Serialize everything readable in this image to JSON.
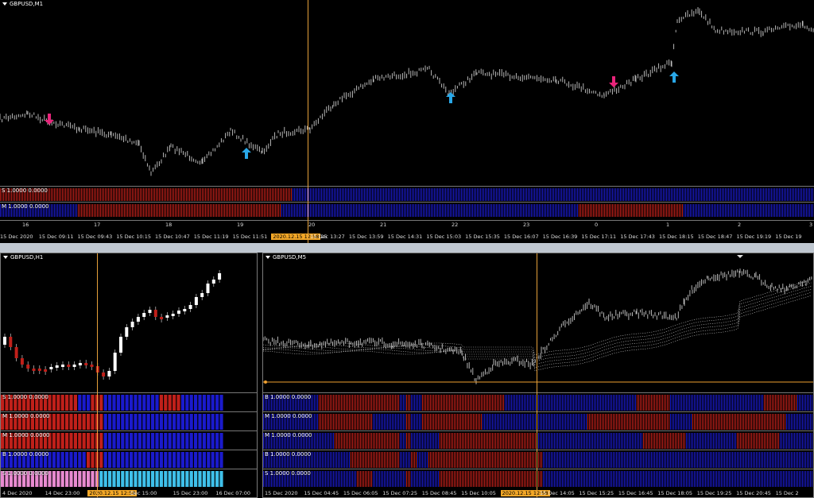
{
  "colors": {
    "bull": "#1a1acc",
    "bear": "#c0201a",
    "cursor": "#f0a030",
    "up_arrow": "#29a8e8",
    "down_arrow": "#e8247a",
    "price": "#c8c8c8"
  },
  "top": {
    "title": "GBPUSD,M1",
    "bands": [
      {
        "label": "S 1.0000 0.0000",
        "segments": [
          [
            "bear",
            0,
            0.06
          ],
          [
            "bear",
            0.06,
            0.36
          ],
          [
            "bull",
            0.36,
            1.0
          ]
        ]
      },
      {
        "label": "M 1.0000 0.0000",
        "segments": [
          [
            "bull",
            0,
            0.095
          ],
          [
            "bear",
            0.095,
            0.345
          ],
          [
            "bull",
            0.345,
            0.71
          ],
          [
            "bear",
            0.71,
            0.84
          ],
          [
            "bull",
            0.84,
            1.0
          ]
        ]
      }
    ],
    "hour_ticks": [
      "16",
      "17",
      "18",
      "19",
      "20",
      "21",
      "22",
      "23",
      "0",
      "1",
      "2",
      "3"
    ],
    "time_ticks": [
      "15 Dec 2020",
      "15 Dec 09:11",
      "15 Dec 09:43",
      "15 Dec 10:15",
      "15 Dec 10:47",
      "15 Dec 11:19",
      "15 Dec 11:51",
      "",
      "15 Dec 13:27",
      "15 Dec 13:59",
      "15 Dec 14:31",
      "15 Dec 15:03",
      "15 Dec 15:35",
      "15 Dec 16:07",
      "15 Dec 16:39",
      "15 Dec 17:11",
      "15 Dec 17:43",
      "15 Dec 18:15",
      "15 Dec 18:47",
      "15 Dec 19:19",
      "15 Dec 19"
    ],
    "cursor_label": "2020.12.15 12:58",
    "cursor_suffix": "25"
  },
  "h1": {
    "title": "GBPUSD,H1",
    "bands": [
      {
        "label": "S 1.0000 0.0000"
      },
      {
        "label": "M 1.0000 0.0000"
      },
      {
        "label": "M 1.0000 0.0000"
      },
      {
        "label": "B 1.0000 0.0000"
      },
      {
        "label": "S 1.0000 0.0000"
      }
    ],
    "time_ticks": [
      "4 Dec 2020",
      "14 Dec 23:00",
      "",
      "Dec 15:00",
      "15 Dec 23:00",
      "16 Dec 07:00"
    ],
    "cursor_label": "2020.12.15 12:58"
  },
  "m5": {
    "title": "GBPUSD,M5",
    "bands": [
      {
        "label": "B 1.0000 0.0000",
        "segments": [
          [
            "bull",
            0,
            0.1
          ],
          [
            "bear",
            0.1,
            0.25
          ],
          [
            "bull",
            0.25,
            0.26
          ],
          [
            "bear",
            0.26,
            0.27
          ],
          [
            "bull",
            0.27,
            0.29
          ],
          [
            "bear",
            0.29,
            0.44
          ],
          [
            "bull",
            0.44,
            0.68
          ],
          [
            "bear",
            0.68,
            0.74
          ],
          [
            "bull",
            0.74,
            0.91
          ],
          [
            "bear",
            0.91,
            0.97
          ],
          [
            "bull",
            0.97,
            1.0
          ]
        ]
      },
      {
        "label": "M 1.0000 0.0000",
        "segments": [
          [
            "bull",
            0,
            0.1
          ],
          [
            "bear",
            0.1,
            0.2
          ],
          [
            "bull",
            0.2,
            0.26
          ],
          [
            "bear",
            0.26,
            0.27
          ],
          [
            "bull",
            0.27,
            0.29
          ],
          [
            "bear",
            0.29,
            0.4
          ],
          [
            "bull",
            0.4,
            0.59
          ],
          [
            "bear",
            0.59,
            0.74
          ],
          [
            "bull",
            0.74,
            0.78
          ],
          [
            "bear",
            0.78,
            0.95
          ],
          [
            "bull",
            0.95,
            1.0
          ]
        ]
      },
      {
        "label": "M 1.0000 0.0000",
        "segments": [
          [
            "bull",
            0,
            0.13
          ],
          [
            "bear",
            0.13,
            0.25
          ],
          [
            "bull",
            0.25,
            0.26
          ],
          [
            "bear",
            0.26,
            0.27
          ],
          [
            "bull",
            0.27,
            0.32
          ],
          [
            "bear",
            0.32,
            0.5
          ],
          [
            "bull",
            0.5,
            0.69
          ],
          [
            "bear",
            0.69,
            0.77
          ],
          [
            "bull",
            0.77,
            0.86
          ],
          [
            "bear",
            0.86,
            0.94
          ],
          [
            "bull",
            0.94,
            1.0
          ]
        ]
      },
      {
        "label": "B 1.0000 0.0000",
        "segments": [
          [
            "bull",
            0,
            0.16
          ],
          [
            "bear",
            0.16,
            0.25
          ],
          [
            "bull",
            0.25,
            0.27
          ],
          [
            "bear",
            0.27,
            0.28
          ],
          [
            "bull",
            0.28,
            0.3
          ],
          [
            "bear",
            0.3,
            0.51
          ],
          [
            "bull",
            0.51,
            1.0
          ]
        ]
      },
      {
        "label": "S 1.0000 0.0000",
        "segments": [
          [
            "bull",
            0,
            0.17
          ],
          [
            "bear",
            0.17,
            0.2
          ],
          [
            "bull",
            0.2,
            0.26
          ],
          [
            "bear",
            0.26,
            0.27
          ],
          [
            "bull",
            0.27,
            0.32
          ],
          [
            "bear",
            0.32,
            0.51
          ],
          [
            "bull",
            0.51,
            1.0
          ]
        ]
      }
    ],
    "time_ticks": [
      "15 Dec 2020",
      "15 Dec 04:45",
      "15 Dec 06:05",
      "15 Dec 07:25",
      "15 Dec 08:45",
      "15 Dec 10:05",
      "",
      "15 Dec 14:05",
      "15 Dec 15:25",
      "15 Dec 16:45",
      "15 Dec 18:05",
      "15 Dec 19:25",
      "15 Dec 20:45",
      "15 Dec 2"
    ],
    "cursor_label": "2020.12.15 12:58"
  }
}
